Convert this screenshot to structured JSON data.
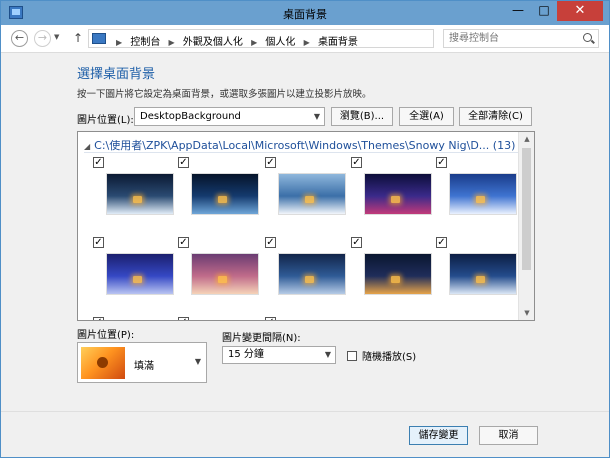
{
  "window": {
    "title": "桌面背景"
  },
  "titlebar": {
    "min_glyph": "—",
    "max_glyph": "□",
    "close_glyph": "✕"
  },
  "address": {
    "crumbs": [
      "控制台",
      "外觀及個人化",
      "個人化",
      "桌面背景"
    ],
    "search_placeholder": "搜尋控制台"
  },
  "page": {
    "title": "選擇桌面背景",
    "instruction": "按一下圖片將它設定為桌面背景，或選取多張圖片以建立投影片放映。",
    "location_label": "圖片位置(L):",
    "location_value": "DesktopBackground",
    "browse_label": "瀏覽(B)...",
    "select_all_label": "全選(A)",
    "clear_all_label": "全部清除(C)"
  },
  "gallery": {
    "folder_path": "C:\\使用者\\ZPK\\AppData\\Local\\Microsoft\\Windows\\Themes\\Snowy Nig\\D...",
    "count": "(13)",
    "thumbnails": [
      {
        "checked": true,
        "colors": [
          "#0b1a33",
          "#2a4a72",
          "#e1ecf8"
        ]
      },
      {
        "checked": true,
        "colors": [
          "#06142a",
          "#143a6e",
          "#6fa6d8"
        ]
      },
      {
        "checked": true,
        "colors": [
          "#8fb7dc",
          "#3b6fa8",
          "#f2f6fb"
        ]
      },
      {
        "checked": true,
        "colors": [
          "#0d0e3a",
          "#3a2a8a",
          "#c23a7a"
        ]
      },
      {
        "checked": true,
        "colors": [
          "#1a3c8a",
          "#3f74d1",
          "#eaf2ff"
        ]
      },
      {
        "checked": true,
        "colors": [
          "#1b1f6e",
          "#3548c4",
          "#b9c4f2"
        ]
      },
      {
        "checked": true,
        "colors": [
          "#6a3c72",
          "#c06b8a",
          "#f6d3b8"
        ]
      },
      {
        "checked": true,
        "colors": [
          "#12254a",
          "#2f5b96",
          "#b6cbe6"
        ]
      },
      {
        "checked": true,
        "colors": [
          "#0a1630",
          "#1f2d5a",
          "#e7a44a"
        ]
      },
      {
        "checked": true,
        "colors": [
          "#0c1e44",
          "#244c8c",
          "#dbe7f6"
        ]
      },
      {
        "checked": true,
        "colors": [
          "#cfd8e2",
          "#9fb3c8",
          "#f4f6f9"
        ]
      },
      {
        "checked": true,
        "colors": [
          "#cfd8e2",
          "#9fb3c8",
          "#f4f6f9"
        ]
      },
      {
        "checked": true,
        "colors": [
          "#cfd8e2",
          "#9fb3c8",
          "#f4f6f9"
        ]
      }
    ]
  },
  "position": {
    "label": "圖片位置(P):",
    "value": "填滿"
  },
  "interval": {
    "label": "圖片變更間隔(N):",
    "value": "15 分鐘"
  },
  "shuffle": {
    "label": "隨機播放(S)",
    "checked": false
  },
  "footer": {
    "save_label": "儲存變更",
    "cancel_label": "取消"
  }
}
